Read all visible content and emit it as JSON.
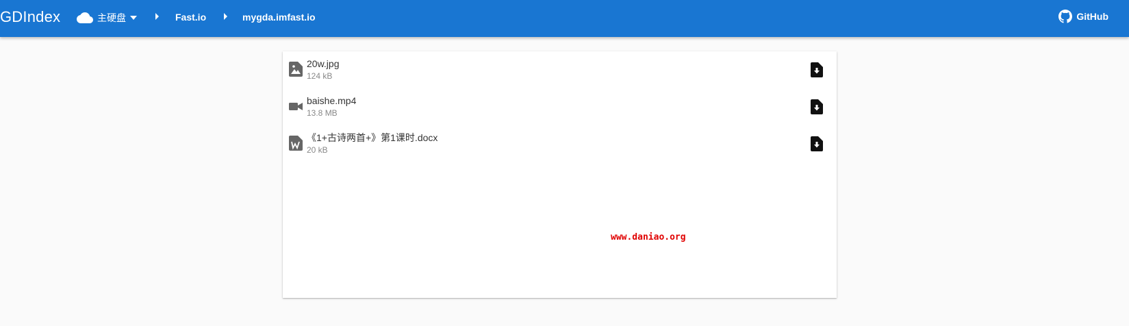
{
  "header": {
    "brand": "GDIndex",
    "drive_label": "主硬盘",
    "breadcrumbs": [
      "Fast.io",
      "mygda.imfast.io"
    ],
    "github_label": "GitHub",
    "bar_color": "#1976d2"
  },
  "files": [
    {
      "name": "20w.jpg",
      "size": "124 kB",
      "icon": "image-file-icon"
    },
    {
      "name": "baishe.mp4",
      "size": "13.8 MB",
      "icon": "video-icon"
    },
    {
      "name": "《1+古诗两首+》第1课时.docx",
      "size": "20 kB",
      "icon": "word-file-icon"
    }
  ],
  "watermark": "www.daniao.org"
}
